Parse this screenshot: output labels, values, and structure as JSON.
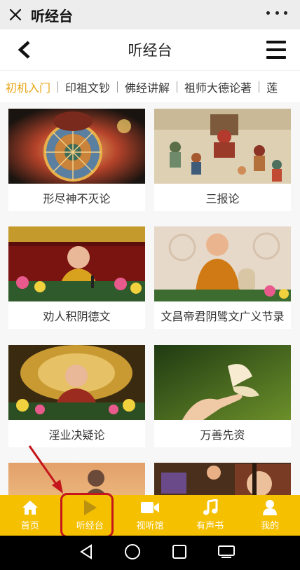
{
  "wechat_bar": {
    "title": "听经台"
  },
  "header": {
    "title": "听经台"
  },
  "tabs": [
    {
      "label": "初机入门",
      "active": true
    },
    {
      "label": "印祖文钞",
      "active": false
    },
    {
      "label": "佛经讲解",
      "active": false
    },
    {
      "label": "祖师大德论著",
      "active": false
    },
    {
      "label": "莲",
      "active": false
    }
  ],
  "cards": [
    {
      "title": "形尽神不灭论",
      "image": "wheel-of-life-thangka"
    },
    {
      "title": "三报论",
      "image": "judgment-hall-painting"
    },
    {
      "title": "劝人积阴德文",
      "image": "monk-lecture-red-hall"
    },
    {
      "title": "文昌帝君阴骘文广义节录",
      "image": "monk-lecture-cloud-backdrop"
    },
    {
      "title": "淫业决疑论",
      "image": "monk-lecture-golden-altar"
    },
    {
      "title": "万善先资",
      "image": "hand-with-butterfly"
    },
    {
      "title": "",
      "image": "sunset-silhouette"
    },
    {
      "title": "",
      "image": "monk-lecture-studio"
    }
  ],
  "bottom_nav": [
    {
      "label": "首页",
      "icon": "home-icon",
      "active": false
    },
    {
      "label": "听经台",
      "icon": "play-icon",
      "active": true
    },
    {
      "label": "视听馆",
      "icon": "video-camera-icon",
      "active": false
    },
    {
      "label": "有声书",
      "icon": "music-note-icon",
      "active": false
    },
    {
      "label": "我的",
      "icon": "user-icon",
      "active": false
    }
  ],
  "colors": {
    "accent": "#f5c000",
    "active_tab": "#e8a412",
    "annotation": "#c4161c"
  }
}
